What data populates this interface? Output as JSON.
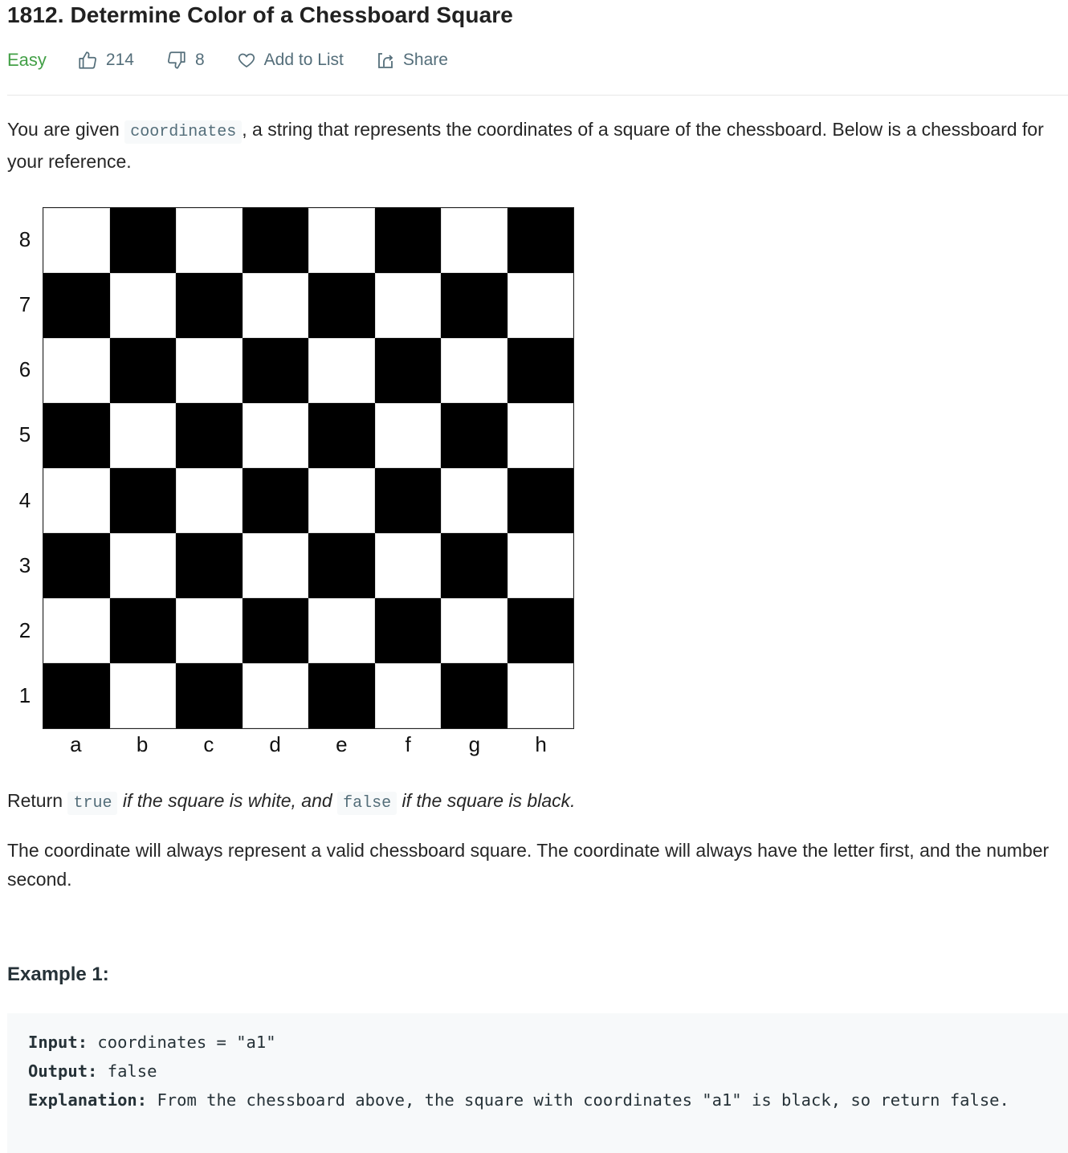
{
  "problem": {
    "title": "1812. Determine Color of a Chessboard Square",
    "difficulty": "Easy",
    "likes": "214",
    "dislikes": "8",
    "add_to_list_label": "Add to List",
    "share_label": "Share",
    "colors": {
      "difficulty": "#43a047",
      "meta_text": "#546e7a",
      "code_bg": "#f7f9fa"
    }
  },
  "description": {
    "p1_before": "You are given ",
    "p1_code": "coordinates",
    "p1_after": ", a string that represents the coordinates of a square of the chessboard. Below is a chessboard for your reference.",
    "p2_before": "Return ",
    "p2_code_true": "true",
    "p2_mid": " if the square is white, and ",
    "p2_code_false": "false",
    "p2_after": " if the square is black.",
    "p3": "The coordinate will always represent a valid chessboard square. The coordinate will always have the letter first, and the number second."
  },
  "chessboard": {
    "ranks": [
      "8",
      "7",
      "6",
      "5",
      "4",
      "3",
      "2",
      "1"
    ],
    "files": [
      "a",
      "b",
      "c",
      "d",
      "e",
      "f",
      "g",
      "h"
    ],
    "a1_color": "black"
  },
  "example1": {
    "title": "Example 1:",
    "input_label": "Input:",
    "input_value": " coordinates = \"a1\"",
    "output_label": "Output:",
    "output_value": " false",
    "explanation_label": "Explanation:",
    "explanation_value": " From the chessboard above, the square with coordinates \"a1\" is black, so return false."
  }
}
